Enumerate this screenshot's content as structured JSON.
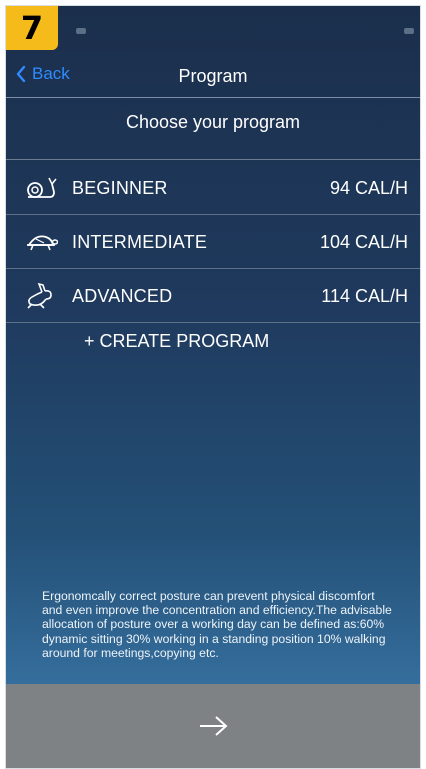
{
  "step_badge": "7",
  "nav": {
    "back_label": "Back",
    "title": "Program"
  },
  "header": {
    "title": "Choose your program"
  },
  "programs": [
    {
      "name": "BEGINNER",
      "calories": "94 CAL/H",
      "icon": "snail-icon"
    },
    {
      "name": "INTERMEDIATE",
      "calories": "104 CAL/H",
      "icon": "turtle-icon"
    },
    {
      "name": "ADVANCED",
      "calories": "114 CAL/H",
      "icon": "rabbit-icon"
    }
  ],
  "create_program_label": "+ CREATE PROGRAM",
  "info_text": "Ergonomcally correct posture can prevent physical discomfort and even improve the concentration and efficiency.The advisable allocation of posture over a working day can be defined as:60% dynamic sitting 30% working in a standing position 10% walking around for meetings,copying etc.",
  "footer": {
    "next_icon": "arrow-right-icon"
  },
  "colors": {
    "badge": "#f5bb1b",
    "back_link": "#2f8cff",
    "footer_bg": "#7f8284"
  }
}
